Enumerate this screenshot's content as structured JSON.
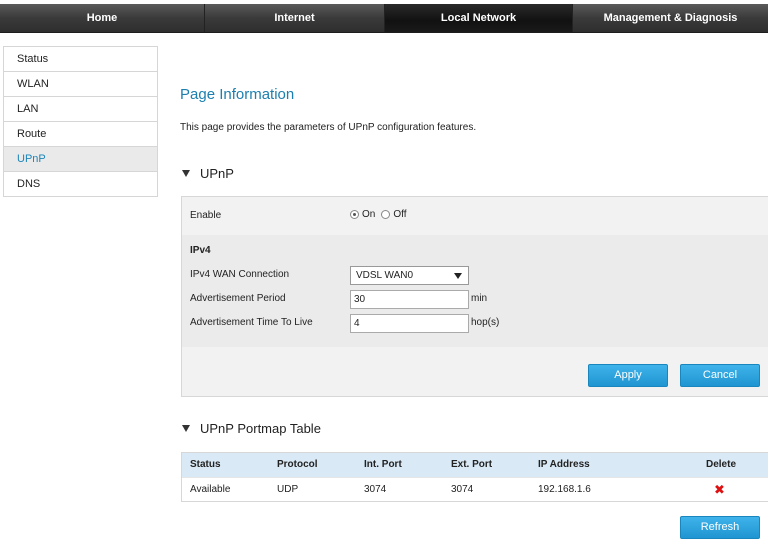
{
  "topnav": {
    "tabs": [
      {
        "label": "Home"
      },
      {
        "label": "Internet"
      },
      {
        "label": "Local Network"
      },
      {
        "label": "Management & Diagnosis"
      }
    ],
    "active_index": 2
  },
  "sidebar": {
    "items": [
      {
        "label": "Status"
      },
      {
        "label": "WLAN"
      },
      {
        "label": "LAN"
      },
      {
        "label": "Route"
      },
      {
        "label": "UPnP"
      },
      {
        "label": "DNS"
      }
    ],
    "active_index": 4
  },
  "page": {
    "title": "Page Information",
    "description": "This page provides the parameters of UPnP configuration features."
  },
  "upnp": {
    "heading": "UPnP",
    "enable_label": "Enable",
    "on_label": "On",
    "off_label": "Off",
    "enabled": true,
    "ipv4_heading": "IPv4",
    "wan_label": "IPv4 WAN Connection",
    "wan_value": "VDSL WAN0",
    "period_label": "Advertisement Period",
    "period_value": "30",
    "period_unit": "min",
    "ttl_label": "Advertisement Time To Live",
    "ttl_value": "4",
    "ttl_unit": "hop(s)",
    "apply_label": "Apply",
    "cancel_label": "Cancel"
  },
  "portmap": {
    "heading": "UPnP Portmap Table",
    "columns": [
      "Status",
      "Protocol",
      "Int. Port",
      "Ext. Port",
      "IP Address",
      "Delete"
    ],
    "rows": [
      {
        "status": "Available",
        "protocol": "UDP",
        "int_port": "3074",
        "ext_port": "3074",
        "ip": "192.168.1.6",
        "delete_icon": "red-x-icon"
      }
    ],
    "refresh_label": "Refresh"
  },
  "colors": {
    "accent": "#1c7fb0",
    "button": "#2ba3de",
    "table_header": "#d9e9f6",
    "delete": "#dd1111"
  }
}
